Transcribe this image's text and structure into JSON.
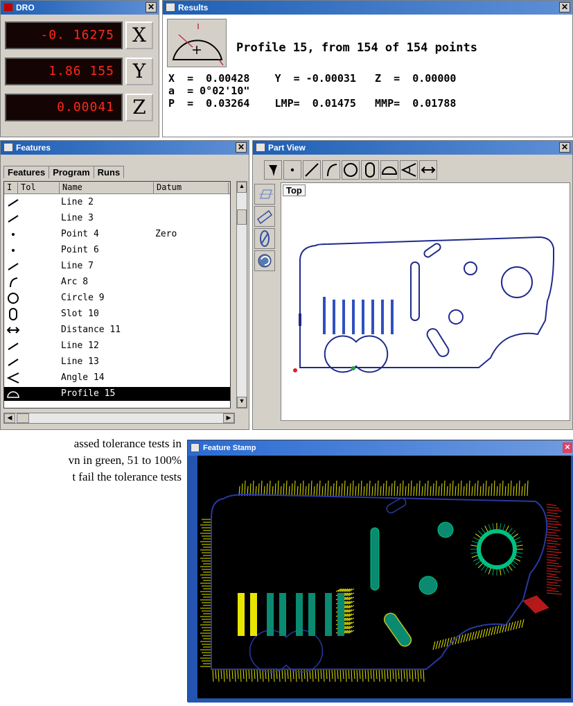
{
  "dro": {
    "title": "DRO",
    "rows": [
      {
        "value": "-0. 16275",
        "axis": "X"
      },
      {
        "value": "1.86 155",
        "axis": "Y"
      },
      {
        "value": "0.00041",
        "axis": "Z"
      }
    ]
  },
  "results": {
    "title": "Results",
    "profile_line": "Profile 15, from 154 of 154 points",
    "line1": "X  =  0.00428    Y  = -0.00031   Z  =  0.00000",
    "line2": "a  = 0°02'10\"",
    "line3": "P  =  0.03264    LMP=  0.01475   MMP=  0.01788"
  },
  "features": {
    "title": "Features",
    "tabs": [
      "Features",
      "Program",
      "Runs"
    ],
    "columns": [
      "I",
      "Tol",
      "Name",
      "Datum"
    ],
    "rows": [
      {
        "icon": "line-icon",
        "name": "Line 2",
        "datum": ""
      },
      {
        "icon": "line-icon",
        "name": "Line 3",
        "datum": ""
      },
      {
        "icon": "point-icon",
        "name": "Point 4",
        "datum": "Zero"
      },
      {
        "icon": "point-icon",
        "name": "Point 6",
        "datum": ""
      },
      {
        "icon": "line-icon",
        "name": "Line 7",
        "datum": ""
      },
      {
        "icon": "arc-icon",
        "name": "Arc 8",
        "datum": ""
      },
      {
        "icon": "circle-icon",
        "name": "Circle 9",
        "datum": ""
      },
      {
        "icon": "slot-icon",
        "name": "Slot 10",
        "datum": ""
      },
      {
        "icon": "distance-icon",
        "name": "Distance 11",
        "datum": ""
      },
      {
        "icon": "line-icon",
        "name": "Line 12",
        "datum": ""
      },
      {
        "icon": "line-icon",
        "name": "Line 13",
        "datum": ""
      },
      {
        "icon": "angle-icon",
        "name": "Angle 14",
        "datum": ""
      },
      {
        "icon": "profile-icon",
        "name": "Profile 15",
        "datum": "",
        "selected": true
      }
    ]
  },
  "part_view": {
    "title": "Part View",
    "view_label": "Top"
  },
  "caption": {
    "line1": "assed tolerance tests in",
    "line2": "vn in green, 51 to 100%",
    "line3": "t fail the tolerance tests"
  },
  "feature_stamp": {
    "title": "Feature Stamp"
  },
  "colors": {
    "title_blue": "#1e5fb4",
    "part_outline": "#1f2a8c",
    "lcd_red": "#ff2a1a",
    "stamp_yellow": "#e6e600",
    "stamp_green": "#00a070",
    "stamp_red": "#e02020"
  }
}
